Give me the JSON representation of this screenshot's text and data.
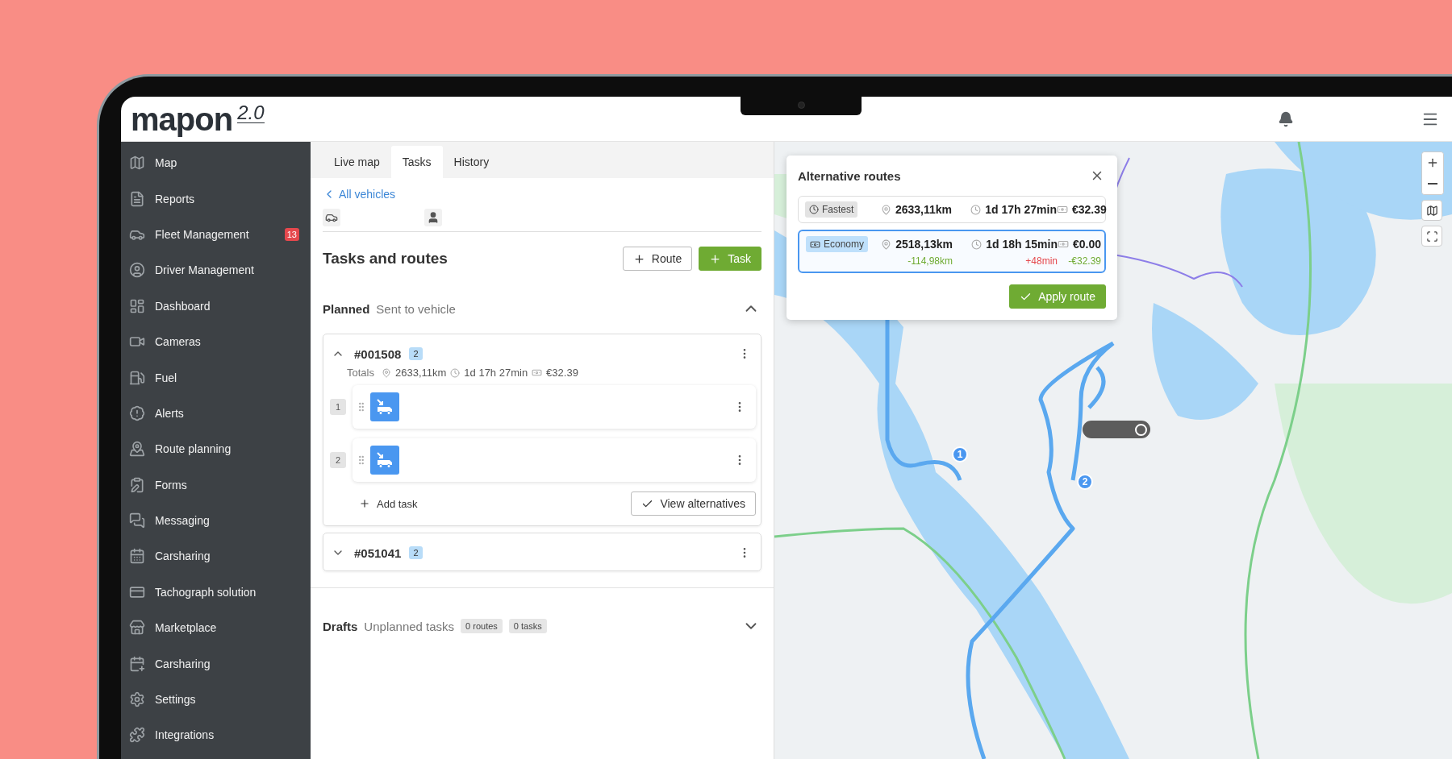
{
  "header": {
    "logo": "mapon",
    "version": "2.0"
  },
  "sidebar": {
    "items": [
      {
        "label": "Map"
      },
      {
        "label": "Reports"
      },
      {
        "label": "Fleet Management",
        "badge": "13"
      },
      {
        "label": "Driver Management"
      },
      {
        "label": "Dashboard"
      },
      {
        "label": "Cameras"
      },
      {
        "label": "Fuel"
      },
      {
        "label": "Alerts"
      },
      {
        "label": "Route planning"
      },
      {
        "label": "Forms"
      },
      {
        "label": "Messaging"
      },
      {
        "label": "Carsharing"
      },
      {
        "label": "Tachograph solution"
      },
      {
        "label": "Marketplace"
      },
      {
        "label": "Carsharing"
      },
      {
        "label": "Settings"
      },
      {
        "label": "Integrations"
      }
    ]
  },
  "tabs": [
    {
      "label": "Live map",
      "selected": false
    },
    {
      "label": "Tasks",
      "selected": true
    },
    {
      "label": "History",
      "selected": false
    }
  ],
  "back_link": "All vehicles",
  "title": "Tasks and routes",
  "actions": [
    "Route",
    "Task"
  ],
  "planned": {
    "title": "Planned",
    "subtitle": "Sent to vehicle",
    "expanded": true,
    "routes": [
      {
        "id": "#001508",
        "count": "2",
        "expanded": true,
        "totals_label": "Totals",
        "distance": "2633,11km",
        "duration": "1d 17h 27min",
        "cost": "€32.39",
        "tasks": [
          {
            "number": "1"
          },
          {
            "number": "2"
          }
        ],
        "add_task": "Add task",
        "alternatives_button": "View alternatives"
      },
      {
        "id": "#051041",
        "count": "2",
        "expanded": false
      }
    ]
  },
  "drafts": {
    "title": "Drafts",
    "subtitle": "Unplanned tasks",
    "chips": [
      "0 routes",
      "0 tasks"
    ],
    "expanded": false
  },
  "alternative_routes": {
    "title": "Alternative routes",
    "options": [
      {
        "kind": "fastest",
        "label": "Fastest",
        "selected": false,
        "distance": "2633,11km",
        "duration": "1d 17h 27min",
        "cost": "€32.39"
      },
      {
        "kind": "economy",
        "label": "Economy",
        "selected": true,
        "distance": "2518,13km",
        "duration": "1d 18h 15min",
        "cost": "€0.00",
        "differences": [
          {
            "text": "-114,98km",
            "color": "#6fab33"
          },
          {
            "text": "+48min",
            "color": "#e5484d"
          },
          {
            "text": "-€32.39",
            "color": "#6fab33"
          }
        ]
      }
    ],
    "apply_button": "Apply route"
  },
  "map": {
    "stops": [
      {
        "number": "1"
      },
      {
        "number": "2"
      }
    ]
  }
}
